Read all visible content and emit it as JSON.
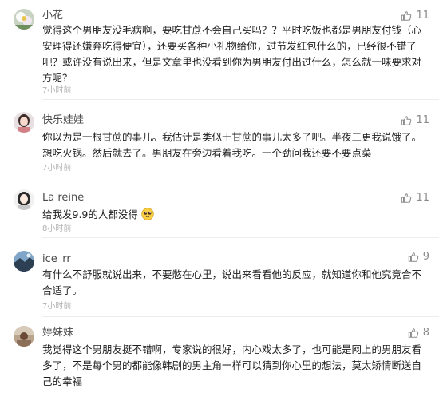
{
  "comments": [
    {
      "username": "小花",
      "likes": "11",
      "text": "觉得这个男朋友没毛病啊，要吃甘蔗不会自己买吗？？平时吃饭也都是男朋友付钱（心安理得还嫌弃吃得便宜），还要买各种小礼物给你，过节发红包什么的，已经很不错了吧？或许没有说出来，但是文章里也没看到你为男朋友付出过什么，怎么就一味要求对方呢？",
      "time": "7小时前",
      "avatar_icon": "avatar-flower-icon"
    },
    {
      "username": "快乐娃娃",
      "likes": "11",
      "text": "你以为是一根甘蔗的事儿。我估计是类似于甘蔗的事儿太多了吧。半夜三更我说饿了。想吃火锅。然后就去了。男朋友在旁边看着我吃。一个劲问我还要不要点菜",
      "time": "7小时前",
      "avatar_icon": "avatar-girl-icon"
    },
    {
      "username": "La reine",
      "likes": "11",
      "text": "给我发9.9的人都没得",
      "emoji": "pleading-face-emoji",
      "time": "8小时前",
      "avatar_icon": "avatar-girl-icon"
    },
    {
      "username": "ice_rr",
      "likes": "9",
      "text": "有什么不舒服就说出来，不要憋在心里，说出来看看他的反应，就知道你和他究竟合不合适了。",
      "time": "7小时前",
      "avatar_icon": "avatar-landscape-icon"
    },
    {
      "username": "婷妹妹",
      "likes": "8",
      "text": "我觉得这个男朋友挺不错啊，专家说的很好，内心戏太多了，也可能是网上的男朋友看多了，不是每个男的都能像韩剧的男主角一样可以猜到你心里的想法，莫太矫情断送自己的幸福",
      "time": "7小时前",
      "avatar_icon": "avatar-photo-icon"
    }
  ],
  "colors": {
    "text": "#1f1f1f",
    "username": "#4a4a4a",
    "meta": "#b2b2b2",
    "like": "#8a8a8a"
  }
}
